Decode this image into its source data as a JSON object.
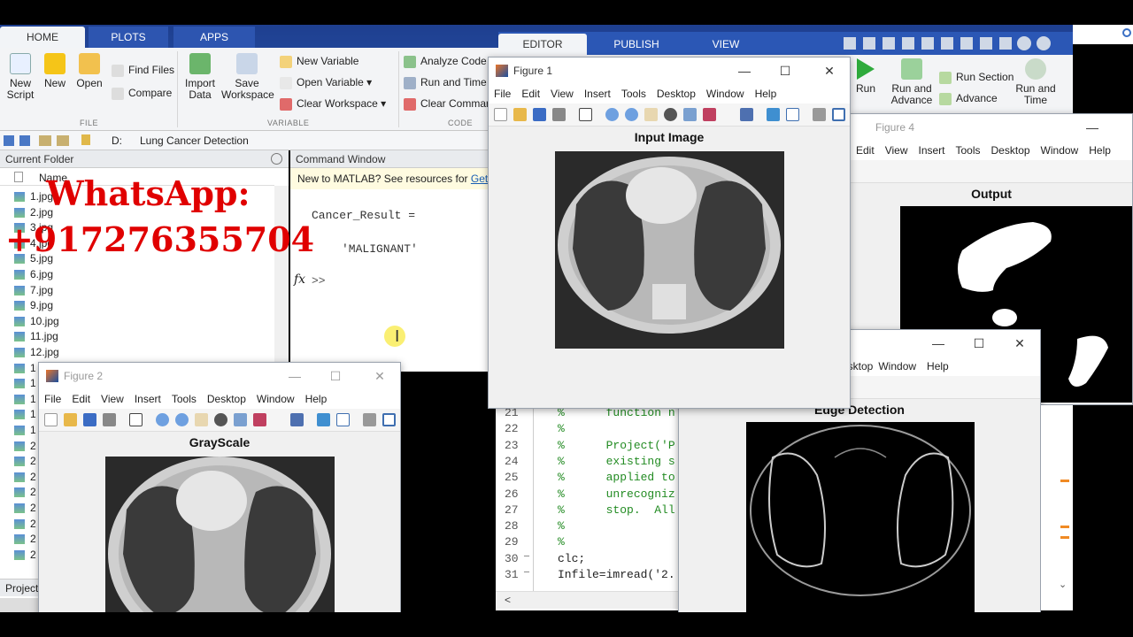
{
  "tabs": {
    "home": "HOME",
    "plots": "PLOTS",
    "apps": "APPS",
    "editor": "EDITOR",
    "publish": "PUBLISH",
    "view": "VIEW"
  },
  "ribbon": {
    "new_script": "New\nScript",
    "new": "New",
    "open": "Open",
    "find_files": "Find Files",
    "compare": "Compare",
    "import_data": "Import\nData",
    "save_workspace": "Save\nWorkspace",
    "new_variable": "New Variable",
    "open_variable": "Open Variable",
    "clear_workspace": "Clear Workspace",
    "analyze_code": "Analyze Code",
    "run_and_time": "Run and Time",
    "clear_commands": "Clear Comman",
    "group_file": "FILE",
    "group_variable": "VARIABLE",
    "group_code": "CODE",
    "run": "Run",
    "run_and_advance": "Run and\nAdvance",
    "run_section": "Run Section",
    "advance": "Advance",
    "run_and_time2": "Run and\nTime"
  },
  "address": {
    "drive": "D:",
    "folder": "Lung Cancer Detection"
  },
  "current_folder": {
    "title": "Current Folder",
    "col_name": "Name",
    "files": [
      "1.jpg",
      "2.jpg",
      "3.jpg",
      "4.jpg",
      "5.jpg",
      "6.jpg",
      "7.jpg",
      "9.jpg",
      "10.jpg",
      "11.jpg",
      "12.jpg",
      "1",
      "1",
      "1",
      "1",
      "1",
      "2",
      "2",
      "2",
      "2",
      "2",
      "2",
      "2",
      "2"
    ],
    "bottom_label": "Project"
  },
  "command_window": {
    "title": "Command Window",
    "banner": "New to MATLAB? See resources for ",
    "banner_link": "Gett",
    "var_line": "Cancer_Result =",
    "value_line": "'MALIGNANT'",
    "prompt": ">>",
    "fx": "fx"
  },
  "overlay": {
    "line1": "WhatsApp:",
    "line2": "+917276355704"
  },
  "menu": {
    "file": "File",
    "edit": "Edit",
    "view": "View",
    "insert": "Insert",
    "tools": "Tools",
    "desktop": "Desktop",
    "window": "Window",
    "help": "Help"
  },
  "fig1": {
    "title": "Figure 1",
    "plot_title": "Input Image"
  },
  "fig2": {
    "title": "Figure 2",
    "plot_title": "GrayScale"
  },
  "fig4": {
    "title": "Figure 4",
    "plot_title": "Output"
  },
  "fig5": {
    "plot_title": "Edge Detection",
    "menu_desktop": "esktop"
  },
  "editor_lines": [
    {
      "n": "21",
      "dash": "",
      "code": "%      function n"
    },
    {
      "n": "22",
      "dash": "",
      "code": "%"
    },
    {
      "n": "23",
      "dash": "",
      "code": "%      Project('P"
    },
    {
      "n": "24",
      "dash": "",
      "code": "%      existing s"
    },
    {
      "n": "25",
      "dash": "",
      "code": "%      applied to"
    },
    {
      "n": "26",
      "dash": "",
      "code": "%      unrecogniz"
    },
    {
      "n": "27",
      "dash": "",
      "code": "%      stop.  All"
    },
    {
      "n": "28",
      "dash": "",
      "code": "%"
    },
    {
      "n": "29",
      "dash": "",
      "code": "%"
    },
    {
      "n": "30",
      "dash": "—",
      "code": "clc;"
    },
    {
      "n": "31",
      "dash": "—",
      "code": "Infile=imread('2."
    }
  ],
  "colors": {
    "accent": "#1e3f8f",
    "overlay_red": "#e00000",
    "comment_green": "#228b22"
  }
}
